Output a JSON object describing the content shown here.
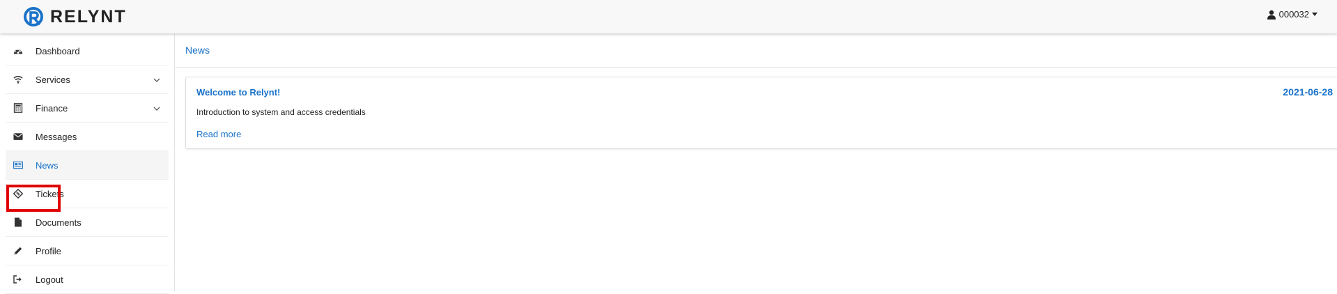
{
  "header": {
    "logo_text": "RELYNT",
    "user_label": "000032",
    "user_icon": "user-icon"
  },
  "sidebar": {
    "items": [
      {
        "label": "Dashboard",
        "icon": "dashboard-icon"
      },
      {
        "label": "Services",
        "icon": "wifi-icon",
        "has_submenu": true
      },
      {
        "label": "Finance",
        "icon": "calculator-icon",
        "has_submenu": true
      },
      {
        "label": "Messages",
        "icon": "envelope-icon"
      },
      {
        "label": "News",
        "icon": "newspaper-icon",
        "active": true
      },
      {
        "label": "Tickets",
        "icon": "ticket-icon"
      },
      {
        "label": "Documents",
        "icon": "document-icon"
      },
      {
        "label": "Profile",
        "icon": "pencil-icon"
      },
      {
        "label": "Logout",
        "icon": "logout-icon"
      }
    ]
  },
  "main": {
    "breadcrumb": "News",
    "news": [
      {
        "title": "Welcome to Relynt!",
        "date": "2021-06-28",
        "description": "Introduction to system and access credentials",
        "link_label": "Read more"
      }
    ]
  },
  "colors": {
    "accent": "#1a73c9",
    "highlight": "#e00000",
    "header_bg": "#f8f8f8"
  }
}
